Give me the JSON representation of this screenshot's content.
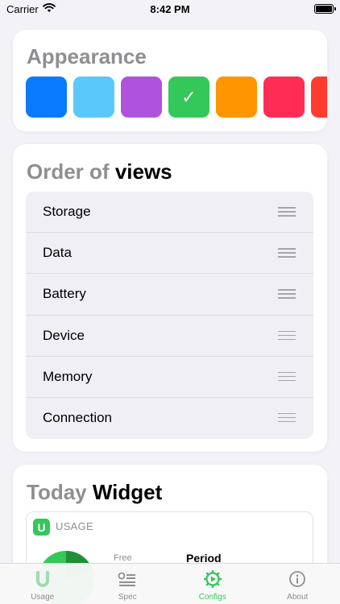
{
  "status_bar": {
    "carrier": "Carrier",
    "time": "8:42 PM"
  },
  "appearance": {
    "title": "Appearance",
    "swatches": [
      {
        "color": "#0a7aff",
        "selected": false
      },
      {
        "color": "#5ac8fa",
        "selected": false
      },
      {
        "color": "#af52de",
        "selected": false
      },
      {
        "color": "#34c759",
        "selected": true,
        "check": "✓"
      },
      {
        "color": "#ff9500",
        "selected": false
      },
      {
        "color": "#ff2d55",
        "selected": false
      },
      {
        "color": "#ff3b30",
        "selected": false
      }
    ]
  },
  "order": {
    "title_muted": "Order of",
    "title_dark": "views",
    "items": [
      "Storage",
      "Data",
      "Battery",
      "Device",
      "Memory",
      "Connection"
    ]
  },
  "widget": {
    "title_muted": "Today",
    "title_dark": "Widget",
    "icon_letter": "U",
    "usage_label": "USAGE",
    "free_label": "Free",
    "period_label": "Period"
  },
  "tab_bar": {
    "tabs": [
      {
        "label": "Usage",
        "icon": "usage-icon",
        "active": false
      },
      {
        "label": "Spec",
        "icon": "spec-icon",
        "active": false
      },
      {
        "label": "Configs",
        "icon": "configs-icon",
        "active": true
      },
      {
        "label": "About",
        "icon": "about-icon",
        "active": false
      }
    ]
  },
  "colors": {
    "accent": "#34c759",
    "muted_text": "#8e8e93"
  }
}
